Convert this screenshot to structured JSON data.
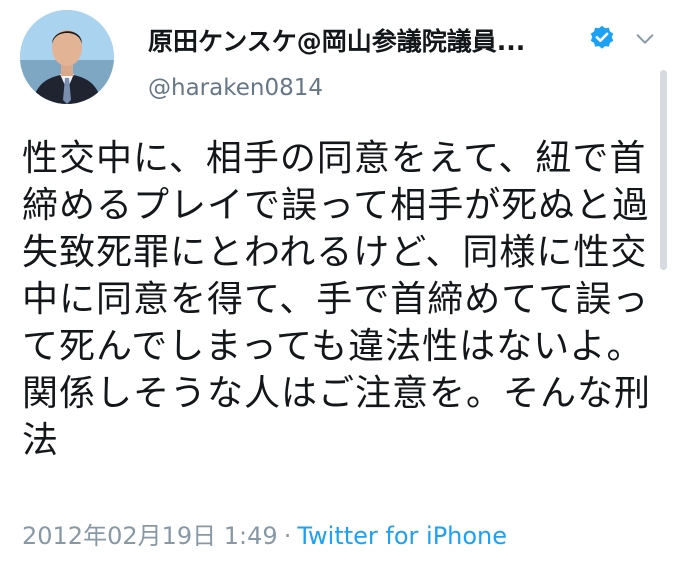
{
  "user": {
    "display_name": "原田ケンスケ@岡山参議院議員...",
    "handle": "@haraken0814",
    "verified": true
  },
  "tweet": {
    "text": "性交中に、相手の同意をえて、紐で首締めるプレイで誤って相手が死ぬと過失致死罪にとわれるけど、同様に性交中に同意を得て、手で首締めてて誤って死んでしまっても違法性はないよ。関係しそうな人はご注意を。そんな刑法",
    "timestamp": "2012年02月19日 1:49",
    "separator": "·",
    "source": "Twitter for iPhone"
  },
  "colors": {
    "text": "#14171a",
    "secondary": "#657786",
    "link": "#1da1f2",
    "verified": "#1da1f2"
  },
  "icons": [
    "verified-badge-icon",
    "chevron-down-icon",
    "avatar-photo"
  ]
}
